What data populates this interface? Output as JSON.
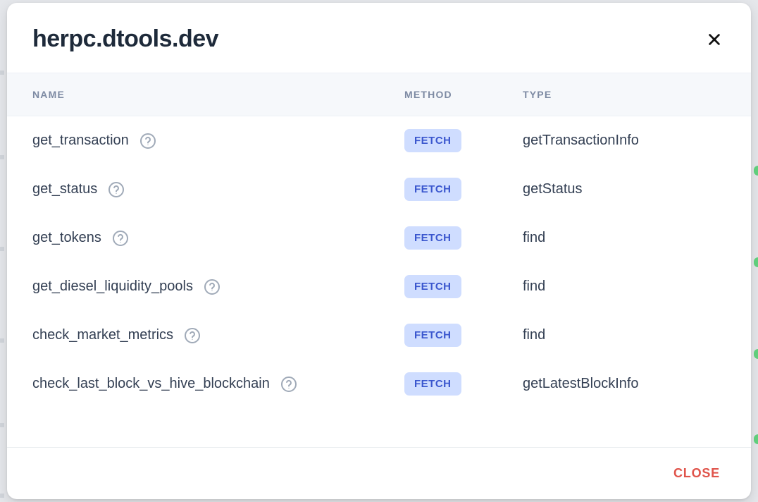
{
  "header": {
    "title": "herpc.dtools.dev"
  },
  "table": {
    "columns": {
      "name": "NAME",
      "method": "METHOD",
      "type": "TYPE"
    },
    "rows": [
      {
        "name": "get_transaction",
        "method": "FETCH",
        "type": "getTransactionInfo",
        "status": "ok"
      },
      {
        "name": "get_status",
        "method": "FETCH",
        "type": "getStatus",
        "status": "ok"
      },
      {
        "name": "get_tokens",
        "method": "FETCH",
        "type": "find",
        "status": "ok"
      },
      {
        "name": "get_diesel_liquidity_pools",
        "method": "FETCH",
        "type": "find",
        "status": "ok"
      },
      {
        "name": "check_market_metrics",
        "method": "FETCH",
        "type": "find",
        "status": "ok"
      },
      {
        "name": "check_last_block_vs_hive_blockchain",
        "method": "FETCH",
        "type": "getLatestBlockInfo",
        "status": "ok"
      }
    ]
  },
  "footer": {
    "close_label": "CLOSE"
  },
  "colors": {
    "status_ok": "#5fcf7a",
    "fetch_bg": "#cfddff",
    "fetch_text": "#3a56ce",
    "close_text": "#e0544b"
  }
}
